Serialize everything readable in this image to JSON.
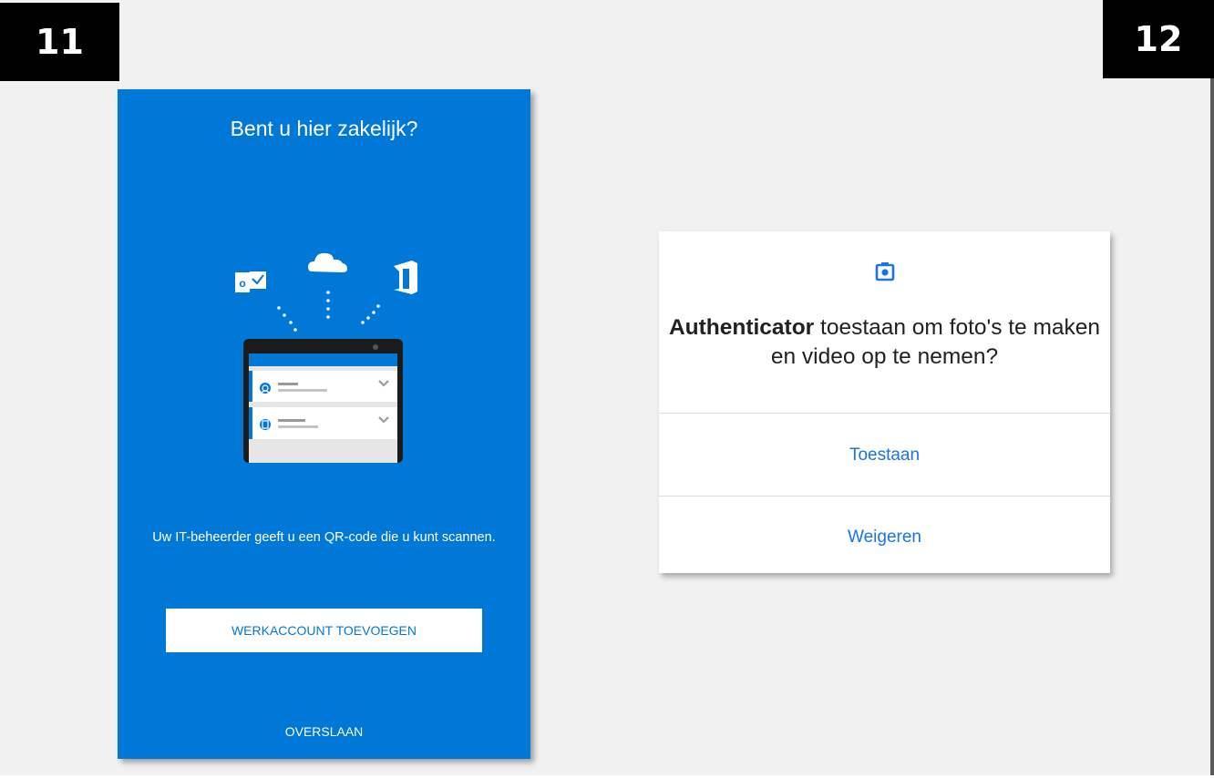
{
  "badges": {
    "left": "11",
    "right": "12"
  },
  "screen11": {
    "title": "Bent u hier zakelijk?",
    "description": "Uw IT-beheerder geeft u een QR-code die u kunt scannen.",
    "add_work_account_label": "WERKACCOUNT TOEVOEGEN",
    "skip_label": "OVERSLAAN",
    "background_color": "#0078d7",
    "illustration_icons": [
      "outlook-icon",
      "onedrive-cloud-icon",
      "office-icon",
      "tablet-icon"
    ]
  },
  "screen12": {
    "icon": "camera-icon",
    "message_app": "Authenticator",
    "message_rest": " toestaan om foto's te maken en video op te nemen?",
    "allow_label": "Toestaan",
    "deny_label": "Weigeren",
    "accent_color": "#1a73e8"
  }
}
